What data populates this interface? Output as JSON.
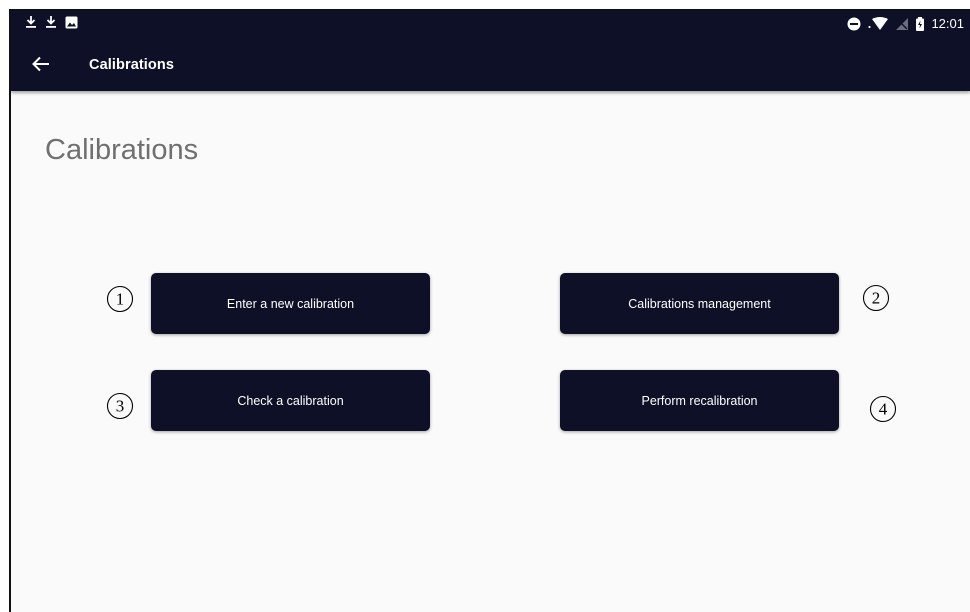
{
  "status_bar": {
    "time": "12:01",
    "left_icons": [
      "download-icon",
      "download-icon",
      "image-icon"
    ],
    "right_icons": [
      "do-not-disturb-icon",
      "wifi-icon",
      "no-signal-icon",
      "battery-icon"
    ]
  },
  "app_bar": {
    "back_icon": "arrow-left-icon",
    "title": "Calibrations"
  },
  "page": {
    "heading": "Calibrations"
  },
  "buttons": [
    {
      "label": "Enter a new calibration",
      "marker": "1"
    },
    {
      "label": "Calibrations management",
      "marker": "2"
    },
    {
      "label": "Check a calibration",
      "marker": "3"
    },
    {
      "label": "Perform recalibration",
      "marker": "4"
    }
  ],
  "colors": {
    "primary": "#0e1027",
    "background": "#fafafa",
    "heading_text": "#707070"
  }
}
